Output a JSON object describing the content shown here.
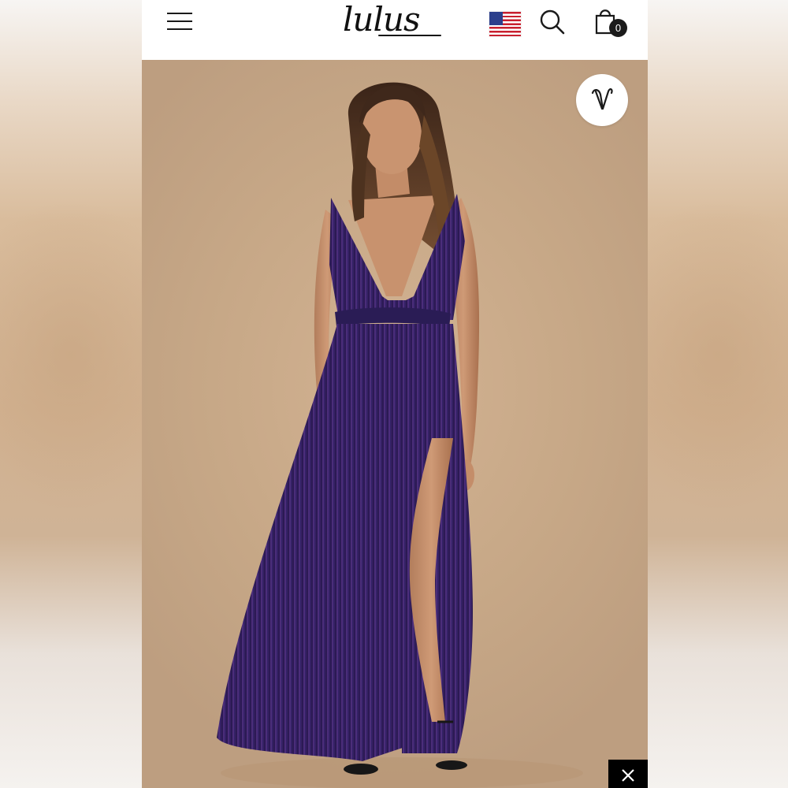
{
  "header": {
    "logo_text": "lulus",
    "cart_count": "0",
    "icons": {
      "menu": "hamburger-menu-icon",
      "flag": "us-flag-icon",
      "search": "search-icon",
      "cart": "shopping-bag-icon"
    }
  },
  "product_image": {
    "wishlist_icon": "heart-icon",
    "close_icon": "close-icon"
  },
  "colors": {
    "header_bg": "#ffffff",
    "photo_bg": "#c7a887",
    "dress": "#2b1f5c",
    "badge": "#1b1b1b"
  }
}
